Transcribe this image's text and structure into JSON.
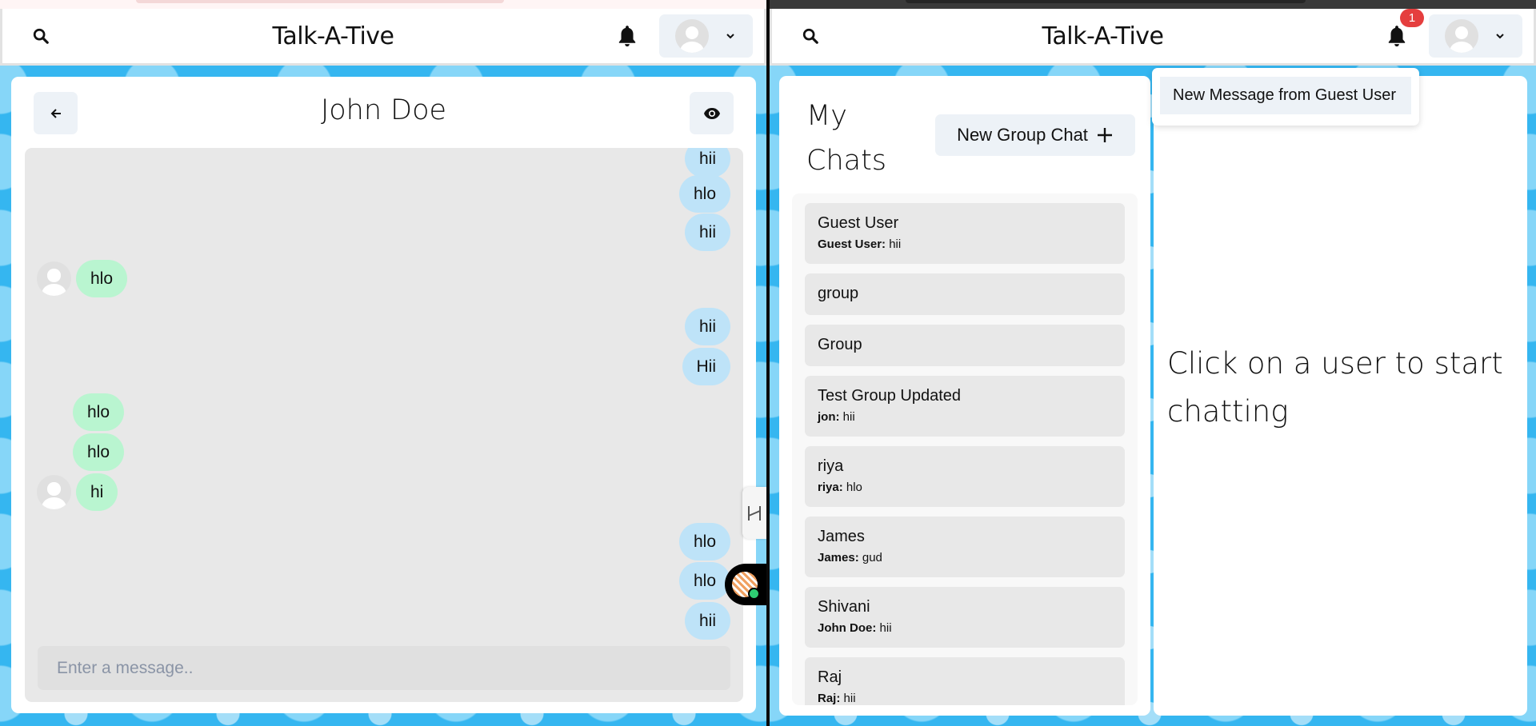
{
  "app": {
    "title": "Talk-A-Tive"
  },
  "left": {
    "chat": {
      "title": "John Doe"
    },
    "messages": [
      {
        "text": "hii",
        "side": "sent",
        "avatar": false
      },
      {
        "text": "hlo",
        "side": "sent",
        "avatar": false
      },
      {
        "text": "hii",
        "side": "sent",
        "avatar": false
      },
      {
        "text": "hlo",
        "side": "recv",
        "avatar": true
      },
      {
        "text": "hii",
        "side": "sent",
        "avatar": false
      },
      {
        "text": "Hii",
        "side": "sent",
        "avatar": false
      },
      {
        "text": "hlo",
        "side": "recv",
        "avatar": false
      },
      {
        "text": "hlo",
        "side": "recv",
        "avatar": false
      },
      {
        "text": "hi",
        "side": "recv",
        "avatar": true
      },
      {
        "text": "hlo",
        "side": "sent",
        "avatar": false
      },
      {
        "text": "hlo",
        "side": "sent",
        "avatar": false
      },
      {
        "text": "hii",
        "side": "sent",
        "avatar": false
      }
    ],
    "input": {
      "placeholder": "Enter a message.."
    }
  },
  "right": {
    "notifications": {
      "count": "1",
      "items": [
        "New Message from Guest User"
      ]
    },
    "my_chats": {
      "title": "My Chats",
      "new_group_label": "New Group Chat",
      "chats": [
        {
          "name": "Guest User",
          "sender": "Guest User:",
          "message": "hii"
        },
        {
          "name": "group",
          "sender": "",
          "message": ""
        },
        {
          "name": "Group",
          "sender": "",
          "message": ""
        },
        {
          "name": "Test Group Updated",
          "sender": "jon:",
          "message": "hii"
        },
        {
          "name": "riya",
          "sender": "riya:",
          "message": "hlo"
        },
        {
          "name": "James",
          "sender": "James:",
          "message": "gud"
        },
        {
          "name": "Shivani",
          "sender": "John Doe:",
          "message": "hii"
        },
        {
          "name": "Raj",
          "sender": "Raj:",
          "message": "hii"
        }
      ]
    },
    "empty_state": {
      "text": "Click on a user to start chatting"
    }
  }
}
